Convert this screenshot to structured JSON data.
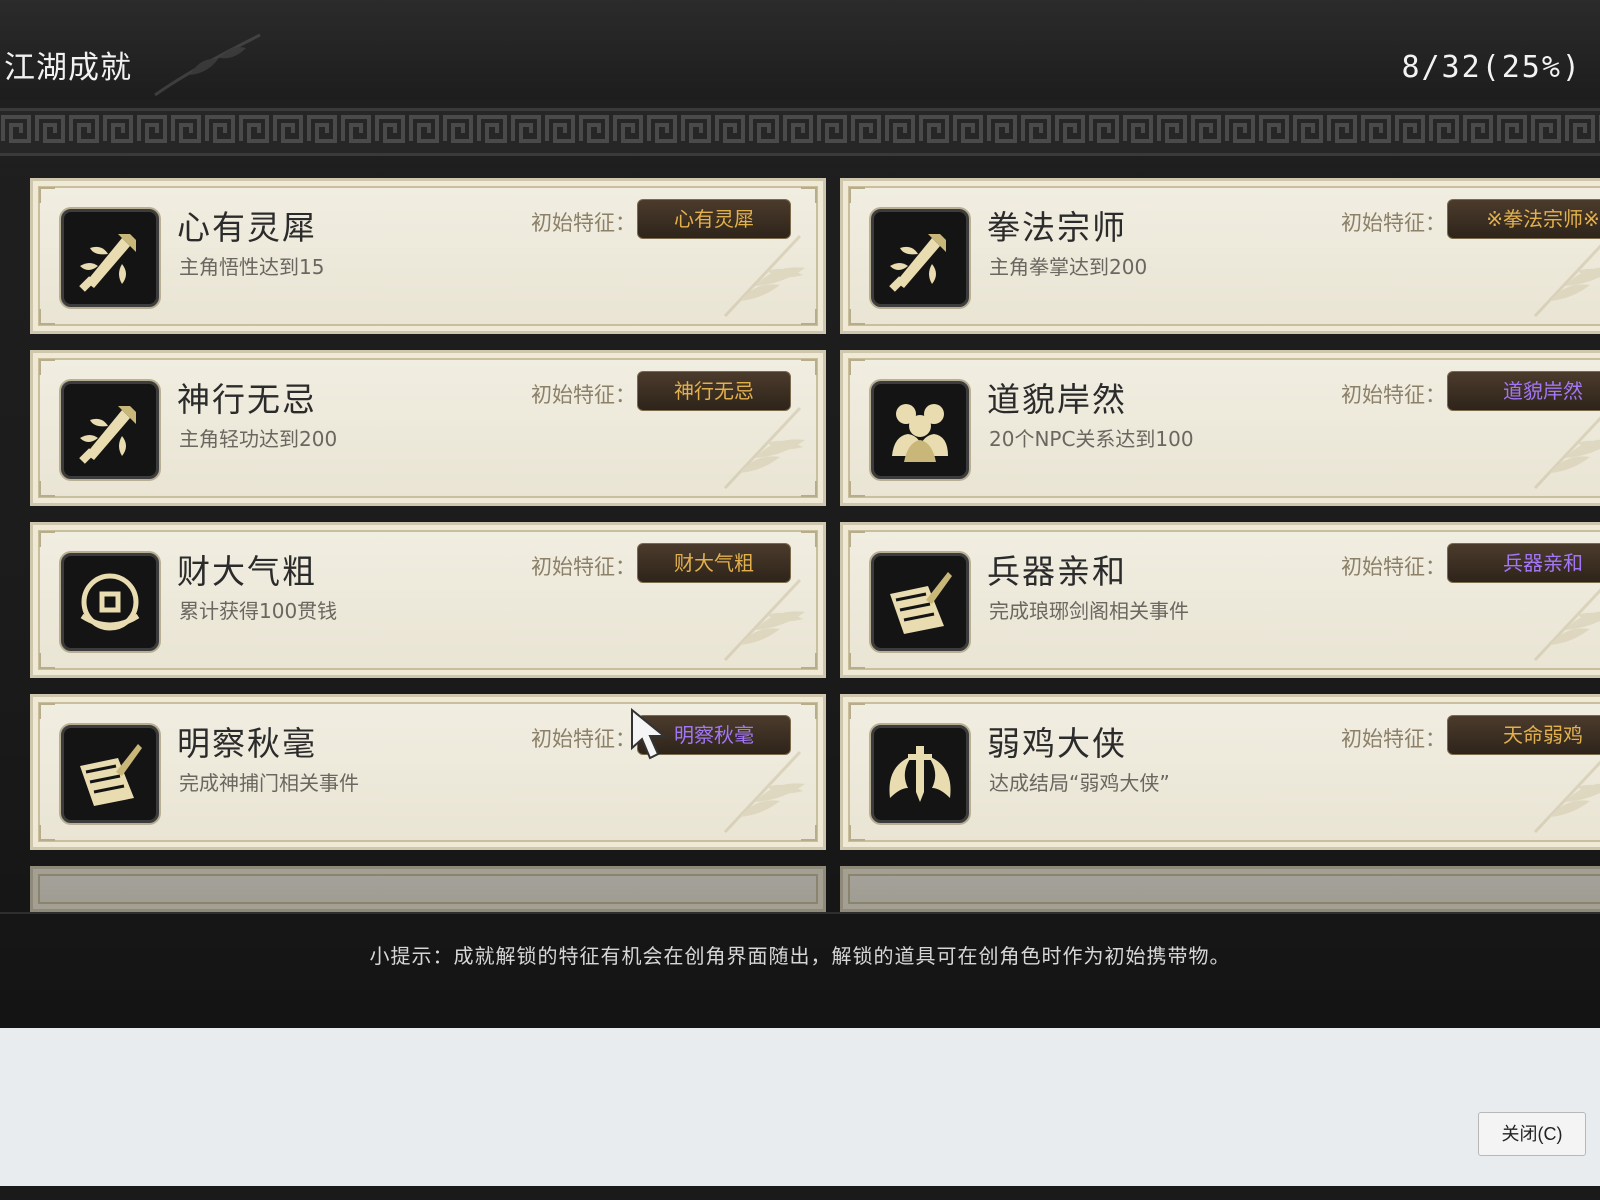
{
  "window": {
    "title": "江湖成就",
    "progress": "8/32(25%)",
    "tip": "小提示：成就解锁的特征有机会在创角界面随出，解锁的道具可在创角色时作为初始携带物。",
    "close_label": "关闭(C)"
  },
  "trait_label": "初始特征：",
  "achievements": [
    {
      "name": "心有灵犀",
      "desc": "主角悟性达到15",
      "trait": "心有灵犀",
      "trait_color": "gold",
      "icon": "sword-flame-icon"
    },
    {
      "name": "拳法宗师",
      "desc": "主角拳掌达到200",
      "trait": "※拳法宗师※",
      "trait_color": "gold",
      "icon": "sword-flame-icon"
    },
    {
      "name": "神行无忌",
      "desc": "主角轻功达到200",
      "trait": "神行无忌",
      "trait_color": "gold",
      "icon": "sword-flame-icon"
    },
    {
      "name": "道貌岸然",
      "desc": "20个NPC关系达到100",
      "trait": "道貌岸然",
      "trait_color": "purple",
      "icon": "crowd-icon"
    },
    {
      "name": "财大气粗",
      "desc": "累计获得100贯钱",
      "trait": "财大气粗",
      "trait_color": "gold",
      "icon": "coins-icon"
    },
    {
      "name": "兵器亲和",
      "desc": "完成琅琊剑阁相关事件",
      "trait": "兵器亲和",
      "trait_color": "purple",
      "icon": "scroll-sword-icon"
    },
    {
      "name": "明察秋毫",
      "desc": "完成神捕门相关事件",
      "trait": "明察秋毫",
      "trait_color": "purple",
      "icon": "scroll-sword-icon"
    },
    {
      "name": "弱鸡大侠",
      "desc": "达成结局“弱鸡大侠”",
      "trait": "天命弱鸡",
      "trait_color": "gold",
      "icon": "sword-wings-icon"
    }
  ],
  "colors": {
    "gold": "#e2b04d",
    "purple": "#a276f5",
    "card_bg": "#ece8d9",
    "panel_bg": "#1d1d1d"
  }
}
